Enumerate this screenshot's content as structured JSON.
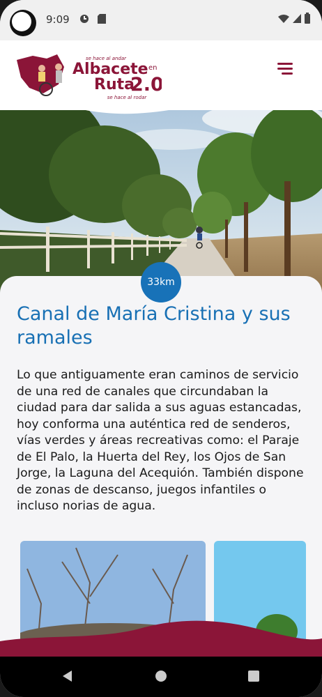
{
  "status_bar": {
    "time": "9:09"
  },
  "header": {
    "logo": {
      "tagline_top": "se hace al andar",
      "name_line1": "Albacete",
      "name_en": "en",
      "name_line2": "Ruta",
      "version": "2.0",
      "tagline_bottom": "se hace al rodar"
    }
  },
  "route": {
    "distance": "33km",
    "title": "Canal de María Cristina y sus ramales",
    "title_line1": "Canal de María Cristina y sus",
    "title_line2": "ramales",
    "description": "Lo que antiguamente eran caminos de servicio de una red de canales que circundaban la ciudad para dar salida a sus aguas estancadas, hoy conforma una auténtica red de senderos, vías verdes y áreas recreativas como: el Paraje de El Palo, la Huerta del Rey, los Ojos de San Jorge, la Laguna del Acequión. También dispone de zonas de descanso, juegos infantiles o incluso norias de agua."
  },
  "colors": {
    "brand": "#8b1538",
    "accent": "#1872b8"
  }
}
